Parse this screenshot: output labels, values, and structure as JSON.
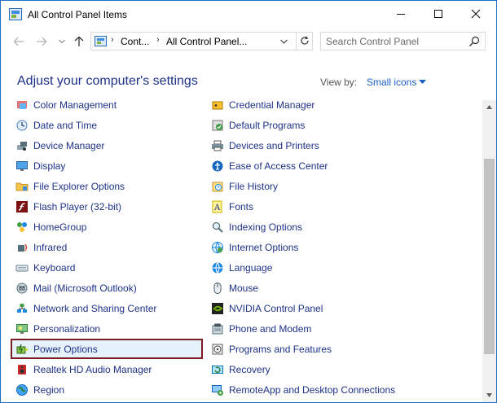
{
  "window": {
    "title": "All Control Panel Items"
  },
  "nav": {
    "breadcrumb": [
      "Cont...",
      "All Control Panel..."
    ],
    "search_placeholder": "Search Control Panel"
  },
  "main": {
    "heading": "Adjust your computer's settings",
    "view_by_label": "View by:",
    "view_by_value": "Small icons"
  },
  "items_left": [
    {
      "label": "Color Management",
      "icon": "color-management-icon"
    },
    {
      "label": "Date and Time",
      "icon": "clock-icon"
    },
    {
      "label": "Device Manager",
      "icon": "device-manager-icon"
    },
    {
      "label": "Display",
      "icon": "monitor-icon"
    },
    {
      "label": "File Explorer Options",
      "icon": "folder-icon"
    },
    {
      "label": "Flash Player (32-bit)",
      "icon": "flash-icon"
    },
    {
      "label": "HomeGroup",
      "icon": "homegroup-icon"
    },
    {
      "label": "Infrared",
      "icon": "infrared-icon"
    },
    {
      "label": "Keyboard",
      "icon": "keyboard-icon"
    },
    {
      "label": "Mail (Microsoft Outlook)",
      "icon": "mail-icon"
    },
    {
      "label": "Network and Sharing Center",
      "icon": "network-icon"
    },
    {
      "label": "Personalization",
      "icon": "personalization-icon"
    },
    {
      "label": "Power Options",
      "icon": "power-icon"
    },
    {
      "label": "Realtek HD Audio Manager",
      "icon": "speaker-icon"
    },
    {
      "label": "Region",
      "icon": "globe-icon"
    }
  ],
  "items_right": [
    {
      "label": "Credential Manager",
      "icon": "credential-icon"
    },
    {
      "label": "Default Programs",
      "icon": "default-programs-icon"
    },
    {
      "label": "Devices and Printers",
      "icon": "printer-icon"
    },
    {
      "label": "Ease of Access Center",
      "icon": "ease-of-access-icon"
    },
    {
      "label": "File History",
      "icon": "file-history-icon"
    },
    {
      "label": "Fonts",
      "icon": "fonts-icon"
    },
    {
      "label": "Indexing Options",
      "icon": "indexing-icon"
    },
    {
      "label": "Internet Options",
      "icon": "internet-icon"
    },
    {
      "label": "Language",
      "icon": "language-icon"
    },
    {
      "label": "Mouse",
      "icon": "mouse-icon"
    },
    {
      "label": "NVIDIA Control Panel",
      "icon": "nvidia-icon"
    },
    {
      "label": "Phone and Modem",
      "icon": "phone-icon"
    },
    {
      "label": "Programs and Features",
      "icon": "programs-icon"
    },
    {
      "label": "Recovery",
      "icon": "recovery-icon"
    },
    {
      "label": "RemoteApp and Desktop Connections",
      "icon": "remoteapp-icon"
    }
  ],
  "selected_item": "Power Options"
}
